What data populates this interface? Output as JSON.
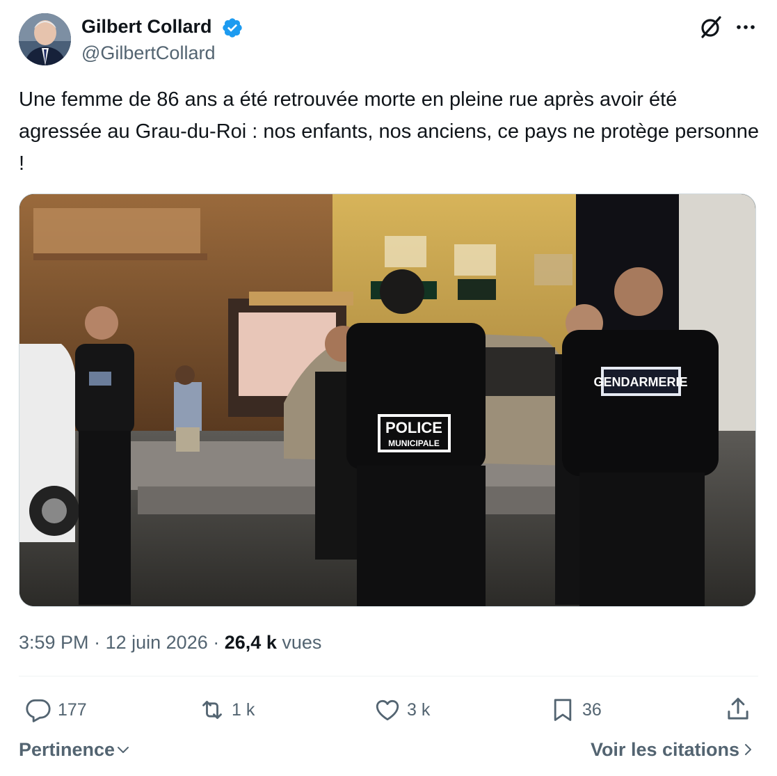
{
  "author": {
    "name": "Gilbert Collard",
    "handle": "@GilbertCollard",
    "verified": true
  },
  "tweet": {
    "text": "Une femme de 86 ans a été retrouvée morte en pleine rue après avoir été agressée au Grau-du-Roi : nos enfants, nos anciens, ce pays ne protège personne !",
    "media_labels": [
      "POLICE",
      "POLICE MUNICIPALE",
      "GENDARMERIE"
    ]
  },
  "meta": {
    "time": "3:59 PM",
    "separator": "·",
    "date": "12 juin 2026",
    "views_count": "26,4 k",
    "views_label": "vues"
  },
  "actions": {
    "replies": "177",
    "reposts": "1 k",
    "likes": "3 k",
    "bookmarks": "36"
  },
  "footer": {
    "sort_label": "Pertinence",
    "quotes_label": "Voir les citations"
  },
  "colors": {
    "text": "#0f1419",
    "muted": "#536471",
    "verified": "#1d9bf0"
  }
}
